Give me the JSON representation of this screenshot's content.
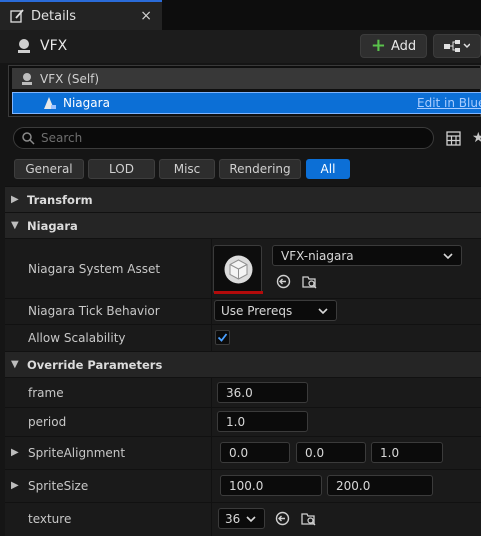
{
  "panel_tab": {
    "title": "Details",
    "close": "×"
  },
  "actor": {
    "name": "VFX",
    "add_label": "Add"
  },
  "components": [
    {
      "label": "VFX (Self)"
    },
    {
      "label": "Niagara",
      "action": "Edit in Blue"
    }
  ],
  "search": {
    "placeholder": "Search"
  },
  "filters": [
    "General",
    "LOD",
    "Misc",
    "Rendering",
    "All"
  ],
  "active_filter": "All",
  "sections": {
    "transform": "Transform",
    "niagara": "Niagara",
    "override": "Override Parameters"
  },
  "niagara": {
    "system_asset_label": "Niagara System Asset",
    "system_asset_value": "VFX-niagara",
    "tick_behavior_label": "Niagara Tick Behavior",
    "tick_behavior_value": "Use Prereqs",
    "allow_scalability_label": "Allow Scalability",
    "allow_scalability_checked": true
  },
  "override_params": {
    "frame_label": "frame",
    "frame_value": "36.0",
    "period_label": "period",
    "period_value": "1.0",
    "sprite_alignment_label": "SpriteAlignment",
    "sprite_alignment_values": [
      "0.0",
      "0.0",
      "1.0"
    ],
    "sprite_size_label": "SpriteSize",
    "sprite_size_values": [
      "100.0",
      "200.0"
    ],
    "texture_label": "texture",
    "texture_value": "36"
  },
  "colors": {
    "accent": "#0c6fd6",
    "add_plus": "#5ac24b",
    "thumb_underline": "#b30b0b"
  }
}
